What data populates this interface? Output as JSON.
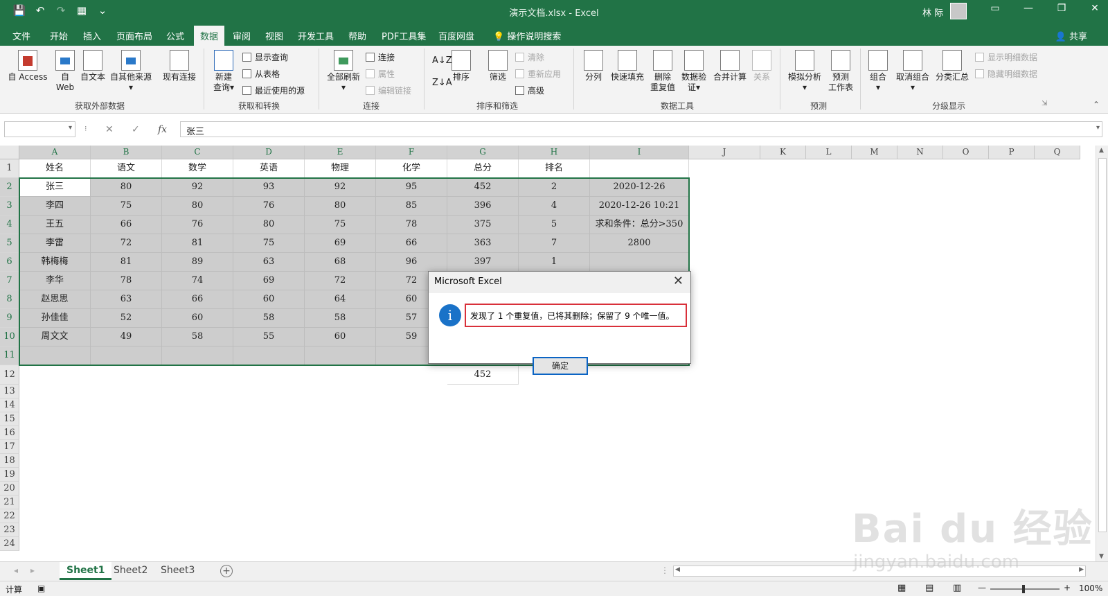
{
  "window": {
    "title": "演示文档.xlsx - Excel",
    "user": "林 际",
    "min": "—",
    "restore": "❐",
    "close": "✕",
    "qat": [
      "💾",
      "↶",
      "↷",
      "▦",
      "⌄"
    ]
  },
  "tabs": [
    {
      "id": "file",
      "label": "文件"
    },
    {
      "id": "home",
      "label": "开始"
    },
    {
      "id": "insert",
      "label": "插入"
    },
    {
      "id": "layout",
      "label": "页面布局"
    },
    {
      "id": "formulas",
      "label": "公式"
    },
    {
      "id": "data",
      "label": "数据"
    },
    {
      "id": "review",
      "label": "审阅"
    },
    {
      "id": "view",
      "label": "视图"
    },
    {
      "id": "developer",
      "label": "开发工具"
    },
    {
      "id": "help",
      "label": "帮助"
    },
    {
      "id": "pdf",
      "label": "PDF工具集"
    },
    {
      "id": "baidu",
      "label": "百度网盘"
    }
  ],
  "tellme": "操作说明搜索",
  "share": "共享",
  "ribbon": {
    "external": {
      "group": "获取外部数据",
      "access": "自 Access",
      "web1": "自",
      "web2": "Web",
      "text": "自文本",
      "other": "自其他来源",
      "existing": "现有连接"
    },
    "transform": {
      "group": "获取和转换",
      "newq1": "新建",
      "newq2": "查询",
      "show": "显示查询",
      "fromtable": "从表格",
      "recent": "最近使用的源"
    },
    "conn": {
      "group": "连接",
      "refresh": "全部刷新",
      "connections": "连接",
      "props": "属性",
      "edit": "编辑链接"
    },
    "sort": {
      "group": "排序和筛选",
      "sort": "排序",
      "filter": "筛选",
      "clear": "清除",
      "reapply": "重新应用",
      "advanced": "高级"
    },
    "tools": {
      "group": "数据工具",
      "split": "分列",
      "flash": "快速填充",
      "dup1": "删除",
      "dup2": "重复值",
      "valid1": "数据验",
      "valid2": "证",
      "consol": "合并计算",
      "rel": "关系"
    },
    "forecast": {
      "group": "预测",
      "whatif": "模拟分析",
      "fs1": "预测",
      "fs2": "工作表"
    },
    "outline": {
      "group": "分级显示",
      "group_btn": "组合",
      "ungroup": "取消组合",
      "subtotal": "分类汇总",
      "showd": "显示明细数据",
      "hided": "隐藏明细数据"
    }
  },
  "formula_bar": {
    "name_box": "",
    "content": "张三"
  },
  "columns": [
    "A",
    "B",
    "C",
    "D",
    "E",
    "F",
    "G",
    "H",
    "I",
    "J",
    "K",
    "L",
    "M",
    "N",
    "O",
    "P",
    "Q"
  ],
  "rows": [
    "1",
    "2",
    "3",
    "4",
    "5",
    "6",
    "7",
    "8",
    "9",
    "10",
    "11",
    "12",
    "13",
    "14",
    "15",
    "16",
    "17",
    "18",
    "19",
    "20",
    "21",
    "22",
    "23",
    "24"
  ],
  "sheet": {
    "r1": [
      "姓名",
      "语文",
      "数学",
      "英语",
      "物理",
      "化学",
      "总分",
      "排名",
      ""
    ],
    "r2": [
      "张三",
      "80",
      "92",
      "93",
      "92",
      "95",
      "452",
      "2",
      "2020-12-26"
    ],
    "r3": [
      "李四",
      "75",
      "80",
      "76",
      "80",
      "85",
      "396",
      "4",
      "2020-12-26 10:21"
    ],
    "r4": [
      "王五",
      "66",
      "76",
      "80",
      "75",
      "78",
      "375",
      "5",
      "求和条件：总分>350"
    ],
    "r5": [
      "李雷",
      "72",
      "81",
      "75",
      "69",
      "66",
      "363",
      "7",
      "2800"
    ],
    "r6": [
      "韩梅梅",
      "81",
      "89",
      "63",
      "68",
      "96",
      "397",
      "1",
      ""
    ],
    "r7": [
      "李华",
      "78",
      "74",
      "69",
      "72",
      "72",
      "",
      "",
      ""
    ],
    "r8": [
      "赵思思",
      "63",
      "66",
      "60",
      "64",
      "60",
      "",
      "",
      ""
    ],
    "r9": [
      "孙佳佳",
      "52",
      "60",
      "58",
      "58",
      "57",
      "",
      "",
      ""
    ],
    "r10": [
      "周文文",
      "49",
      "58",
      "55",
      "60",
      "59",
      "",
      "",
      ""
    ],
    "r12g": "452"
  },
  "sheet_tabs": [
    "Sheet1",
    "Sheet2",
    "Sheet3"
  ],
  "status": {
    "mode": "计算",
    "zoom": "100%"
  },
  "dialog": {
    "title": "Microsoft Excel",
    "info": "i",
    "message": "发现了 1 个重复值，已将其删除；保留了 9 个唯一值。",
    "ok": "确定"
  },
  "watermark": {
    "brand": "Bai du 经验",
    "url": "jingyan.baidu.com"
  }
}
